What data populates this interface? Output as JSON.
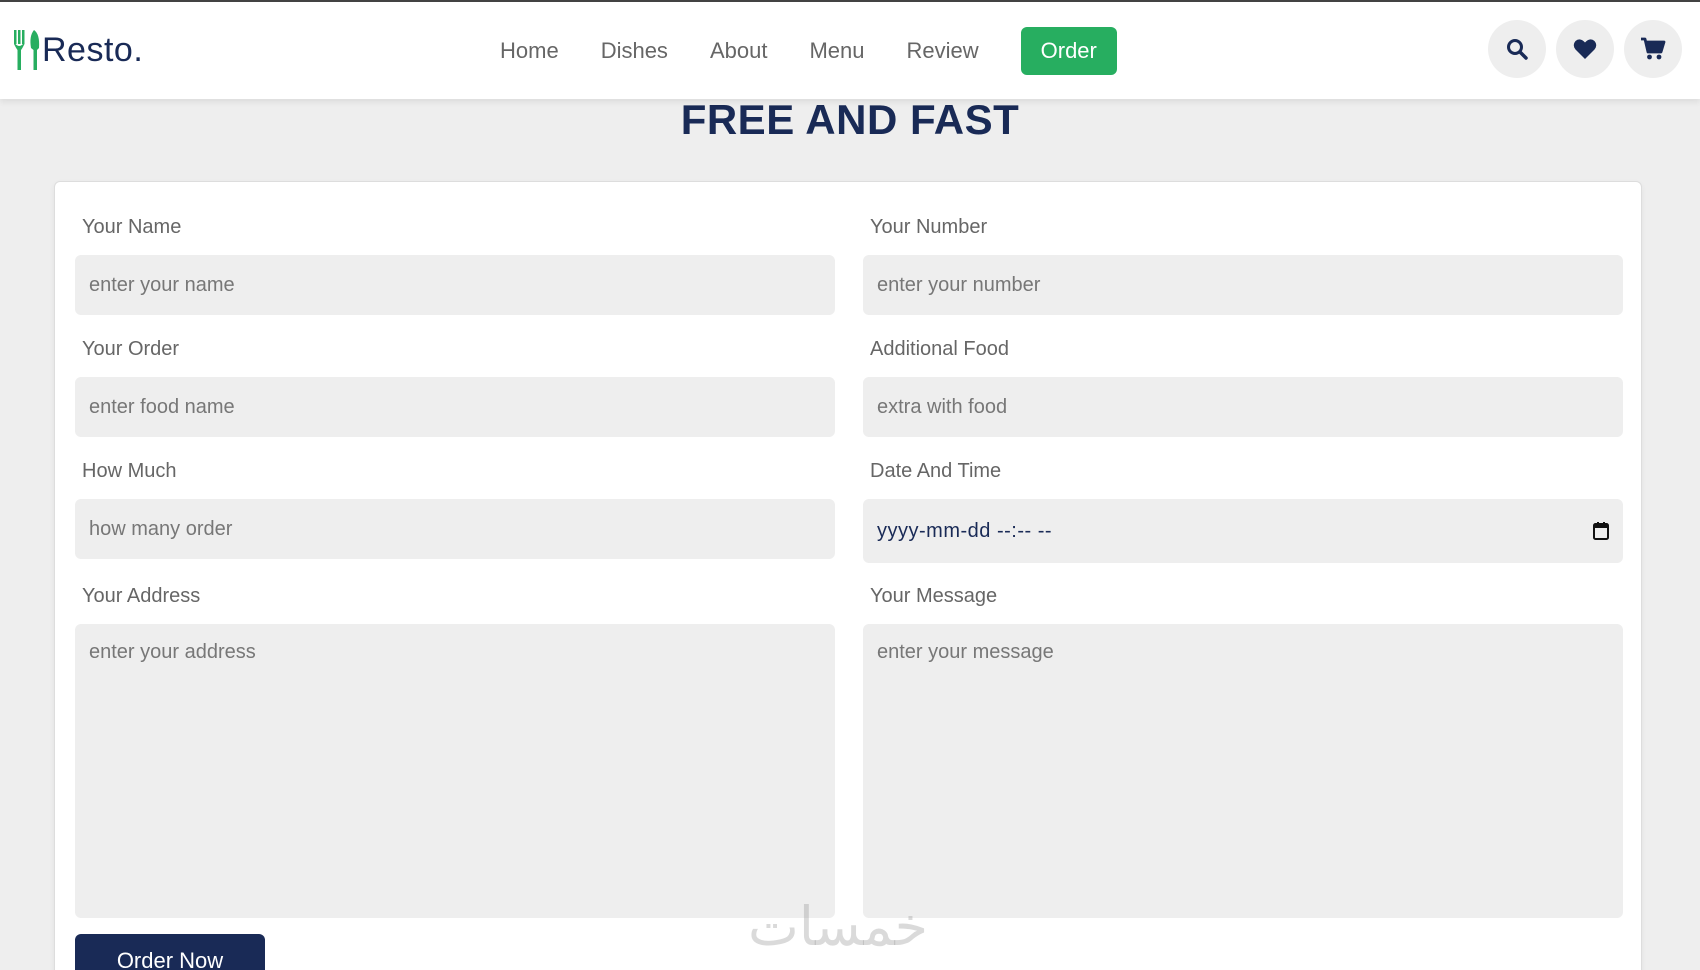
{
  "brand": {
    "name": "Resto."
  },
  "nav": {
    "items": [
      "Home",
      "Dishes",
      "About",
      "Menu",
      "Review"
    ],
    "active": "Order"
  },
  "header_icons": [
    "search-icon",
    "heart-icon",
    "cart-icon"
  ],
  "heading": "FREE AND FAST",
  "form": {
    "name": {
      "label": "Your Name",
      "placeholder": "enter your name"
    },
    "number": {
      "label": "Your Number",
      "placeholder": "enter your number"
    },
    "order": {
      "label": "Your Order",
      "placeholder": "enter food name"
    },
    "additional": {
      "label": "Additional Food",
      "placeholder": "extra with food"
    },
    "quantity": {
      "label": "How Much",
      "placeholder": "how many order"
    },
    "datetime": {
      "label": "Date And Time",
      "value": "yyyy-mm-dd --:-- --"
    },
    "address": {
      "label": "Your Address",
      "placeholder": "enter your address"
    },
    "message": {
      "label": "Your Message",
      "placeholder": "enter your message"
    },
    "submit": "Order Now"
  },
  "watermark": "خمسات",
  "colors": {
    "primary": "#192a56",
    "accent": "#27ae60",
    "background": "#eeeeee"
  }
}
